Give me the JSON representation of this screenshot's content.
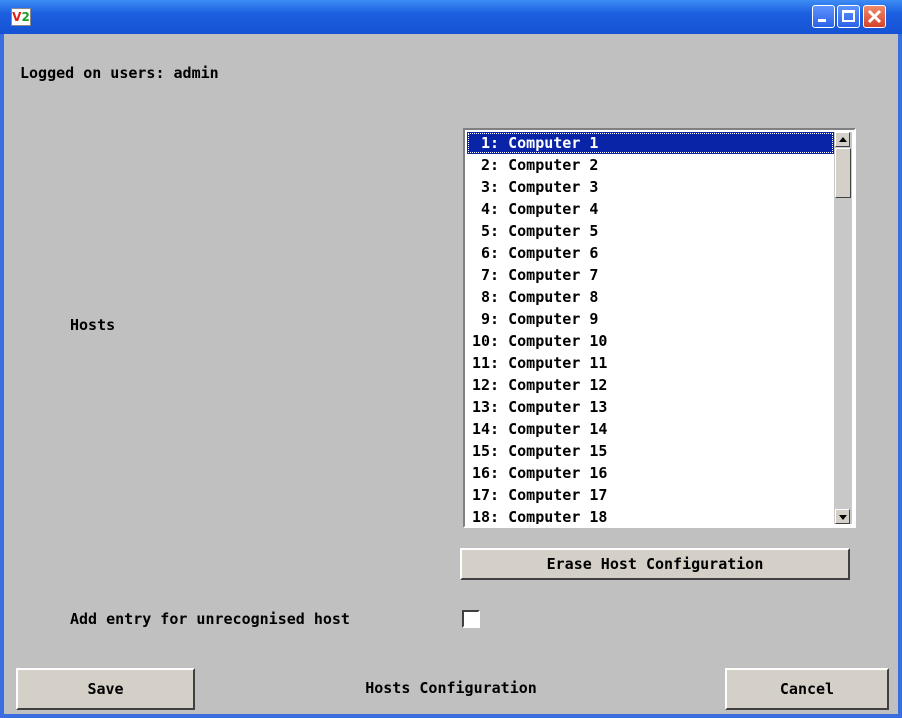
{
  "window": {
    "icon": "V2"
  },
  "header": {
    "logged_on_label": "Logged on users: admin"
  },
  "hosts": {
    "label": "Hosts",
    "items": [
      " 1: Computer 1",
      " 2: Computer 2",
      " 3: Computer 3",
      " 4: Computer 4",
      " 5: Computer 5",
      " 6: Computer 6",
      " 7: Computer 7",
      " 8: Computer 8",
      " 9: Computer 9",
      "10: Computer 10",
      "11: Computer 11",
      "12: Computer 12",
      "13: Computer 13",
      "14: Computer 14",
      "15: Computer 15",
      "16: Computer 16",
      "17: Computer 17",
      "18: Computer 18"
    ],
    "selected_index": 0,
    "erase_button": "Erase Host Configuration"
  },
  "unrecognised": {
    "label": "Add entry for unrecognised host",
    "checked": false
  },
  "footer": {
    "save": "Save",
    "title": "Hosts Configuration",
    "cancel": "Cancel"
  },
  "colors": {
    "titlebar": "#1c5fe0",
    "background": "#c0c0c0",
    "selection": "#0a24a8"
  }
}
